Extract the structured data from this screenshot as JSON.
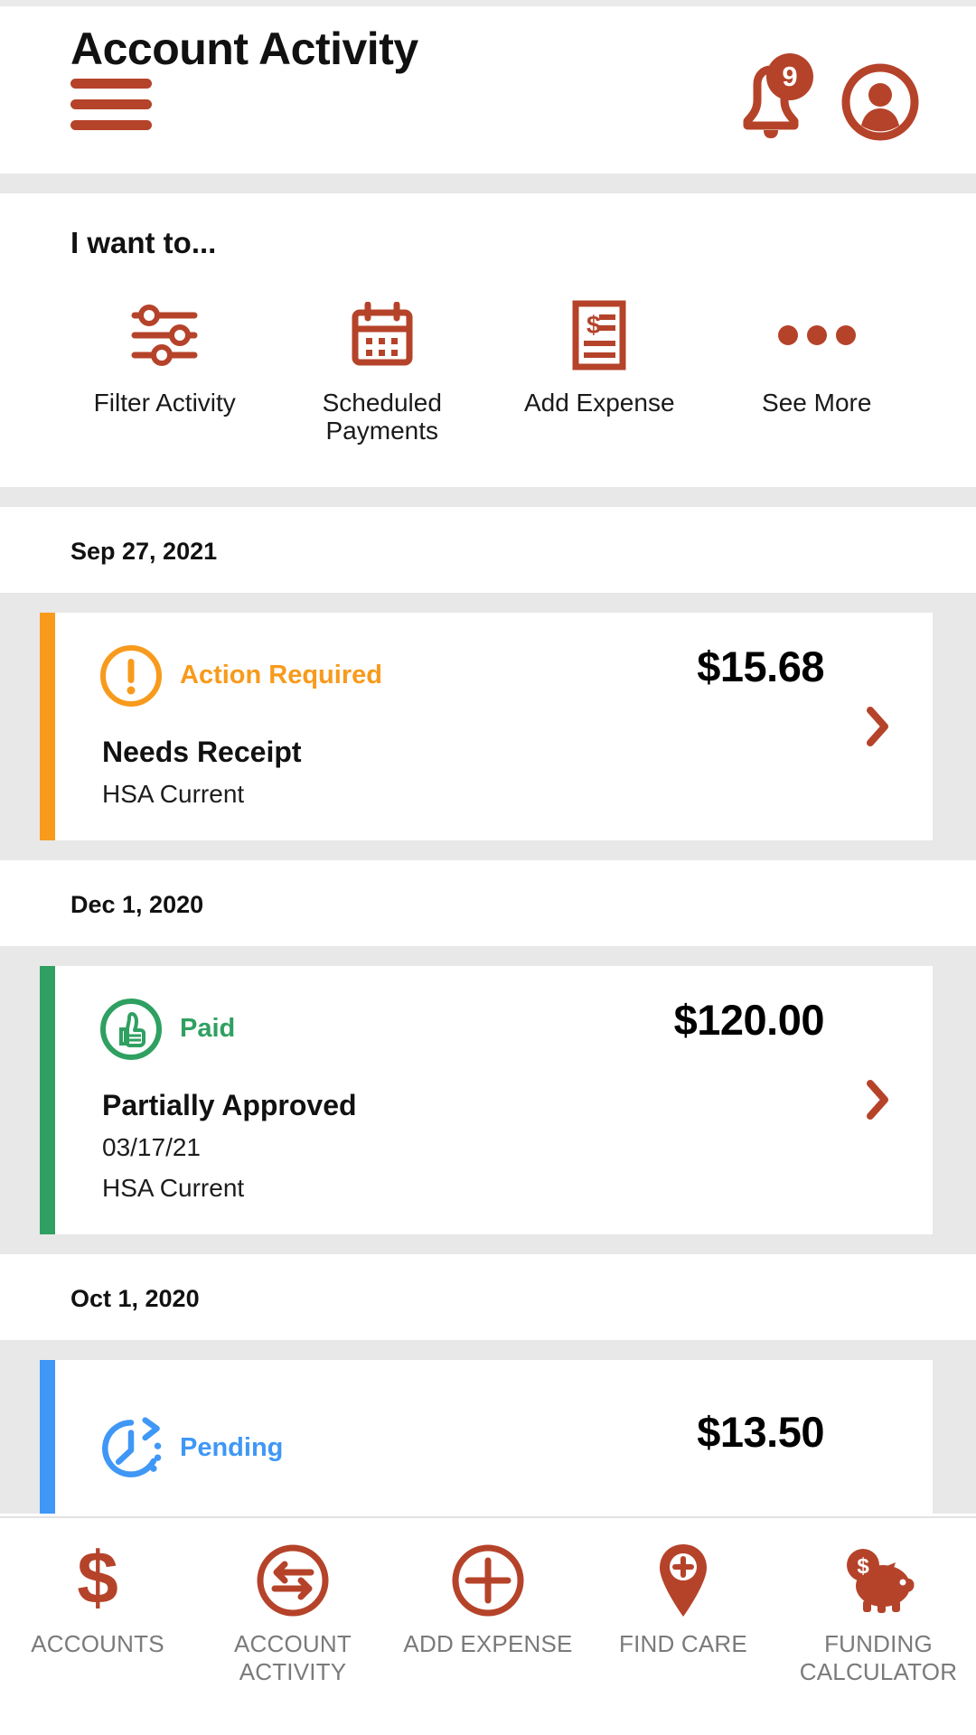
{
  "theme": {
    "brand_red": "#b5432a",
    "warning_orange": "#f89a1c",
    "success_green": "#2fa061",
    "pending_blue": "#3f97f6",
    "page_bg": "#ffffff",
    "band_gray": "#e8e8e8",
    "nav_label_gray": "#7a7a7a"
  },
  "header": {
    "menu_icon": "hamburger-menu-icon",
    "notification_icon": "bell-icon",
    "notification_count": "9",
    "profile_icon": "user-avatar-icon",
    "title": "Account Activity"
  },
  "quick_actions": {
    "heading": "I want to...",
    "items": [
      {
        "label": "Filter Activity",
        "icon": "sliders-filter-icon"
      },
      {
        "label": "Scheduled Payments",
        "icon": "calendar-icon"
      },
      {
        "label": "Add Expense",
        "icon": "receipt-dollar-icon"
      },
      {
        "label": "See More",
        "icon": "ellipsis-icon"
      }
    ]
  },
  "activity": {
    "groups": [
      {
        "date": "Sep 27, 2021",
        "transactions": [
          {
            "status": "Action Required",
            "status_color": "#f89a1c",
            "bar_color": "#f89a1c",
            "status_icon": "exclamation-circle-icon",
            "amount": "$15.68",
            "title": "Needs Receipt",
            "sub_lines": [
              "HSA Current"
            ],
            "chevron": "chevron-right-icon"
          }
        ]
      },
      {
        "date": "Dec 1, 2020",
        "transactions": [
          {
            "status": "Paid",
            "status_color": "#2fa061",
            "bar_color": "#2fa061",
            "status_icon": "thumbs-up-circle-icon",
            "amount": "$120.00",
            "title": "Partially Approved",
            "sub_lines": [
              "03/17/21",
              "HSA Current"
            ],
            "chevron": "chevron-right-icon"
          }
        ]
      },
      {
        "date": "Oct 1, 2020",
        "transactions": [
          {
            "status": "Pending",
            "status_color": "#3f97f6",
            "bar_color": "#3f97f6",
            "status_icon": "clock-pending-icon",
            "amount": "$13.50",
            "title": "",
            "sub_lines": [],
            "chevron": "chevron-right-icon"
          }
        ]
      }
    ]
  },
  "bottom_nav": {
    "items": [
      {
        "label": "ACCOUNTS",
        "icon": "dollar-sign-icon"
      },
      {
        "label": "ACCOUNT ACTIVITY",
        "icon": "transfer-arrows-circle-icon"
      },
      {
        "label": "ADD EXPENSE",
        "icon": "plus-circle-icon"
      },
      {
        "label": "FIND CARE",
        "icon": "map-pin-medical-icon"
      },
      {
        "label": "FUNDING CALCULATOR",
        "icon": "piggy-bank-icon"
      }
    ]
  }
}
